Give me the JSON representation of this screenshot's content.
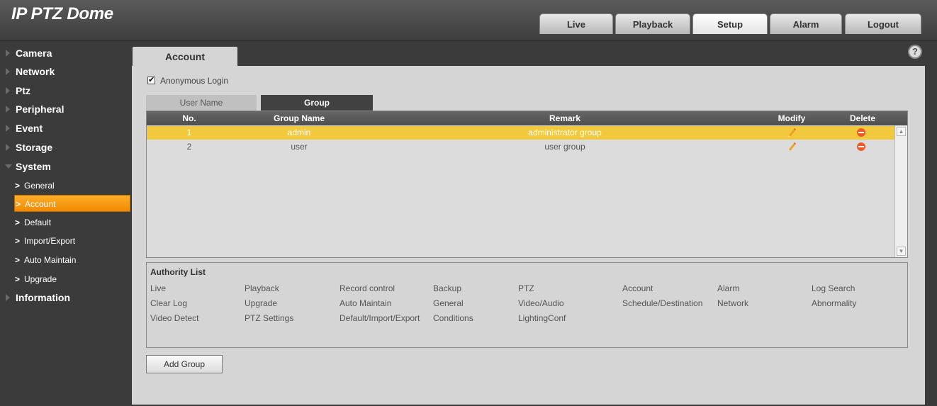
{
  "app": {
    "title": "IP PTZ Dome"
  },
  "topnav": [
    {
      "label": "Live"
    },
    {
      "label": "Playback"
    },
    {
      "label": "Setup",
      "active": true
    },
    {
      "label": "Alarm"
    },
    {
      "label": "Logout"
    }
  ],
  "sidebar": {
    "menus": [
      "Camera",
      "Network",
      "Ptz",
      "Peripheral",
      "Event",
      "Storage",
      "System",
      "Information"
    ],
    "system_sub": [
      "General",
      "Account",
      "Default",
      "Import/Export",
      "Auto Maintain",
      "Upgrade"
    ],
    "active_sub": "Account"
  },
  "page": {
    "tab": "Account",
    "help_icon": "?",
    "anonymous_login": {
      "label": "Anonymous Login",
      "checked": true,
      "checkmark": "✔"
    },
    "subtabs": {
      "user": "User Name",
      "group": "Group"
    }
  },
  "group_table": {
    "headers": {
      "no": "No.",
      "group_name": "Group Name",
      "remark": "Remark",
      "modify": "Modify",
      "delete": "Delete"
    },
    "rows": [
      {
        "no": "1",
        "group_name": "admin",
        "remark": "administrator group",
        "selected": true
      },
      {
        "no": "2",
        "group_name": "user",
        "remark": "user group",
        "selected": false
      }
    ]
  },
  "authority": {
    "title": "Authority List",
    "items": [
      [
        "Live",
        "Playback",
        "Record control",
        "Backup",
        "PTZ",
        "Account",
        "Alarm",
        "Log Search"
      ],
      [
        "Clear Log",
        "Upgrade",
        "Auto Maintain",
        "General",
        "Video/Audio",
        "Schedule/Destination",
        "Network",
        "Abnormality"
      ],
      [
        "Video Detect",
        "PTZ Settings",
        "Default/Import/Export",
        "Conditions",
        "LightingConf"
      ]
    ]
  },
  "buttons": {
    "add_group": "Add Group"
  },
  "colors": {
    "accent_orange": "#f08a00",
    "selected_row": "#f2c83d",
    "delete_icon": "#f05a28"
  }
}
